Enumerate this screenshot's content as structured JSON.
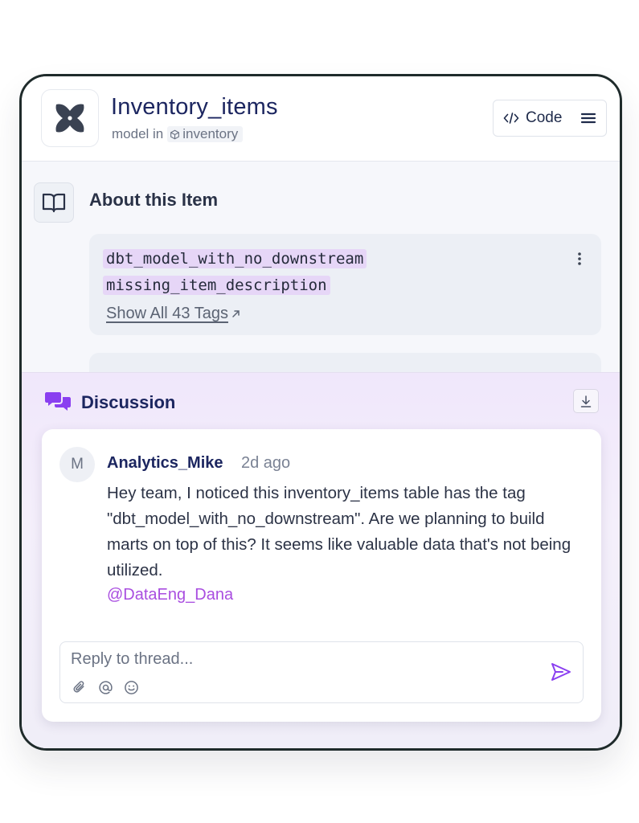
{
  "header": {
    "title": "Inventory_items",
    "subtitle_prefix": "model in",
    "subtitle_project": "inventory",
    "code_label": "Code",
    "logo_icon": "dbt-logo-icon",
    "menu_icon": "hamburger-menu-icon"
  },
  "about": {
    "title": "About this Item",
    "icon": "book-icon",
    "tags": [
      "dbt_model_with_no_downstream",
      "missing_item_description"
    ],
    "show_all_label": "Show All 43 Tags",
    "show_all_icon": "arrow-up-right-icon"
  },
  "discussion": {
    "title": "Discussion",
    "icon": "chat-bubbles-icon",
    "download_icon": "download-icon",
    "comment": {
      "avatar_initial": "M",
      "author": "Analytics_Mike",
      "time": "2d ago",
      "body": "Hey team, I noticed this inventory_items table has the tag \"dbt_model_with_no_downstream\". Are we planning to build marts on top of this? It seems like valuable data that's not being utilized.",
      "mention": "@DataEng_Dana"
    },
    "reply": {
      "placeholder": "Reply to thread...",
      "tools": [
        "paperclip-icon",
        "at-sign-icon",
        "smiley-icon"
      ],
      "send_icon": "send-icon"
    }
  },
  "colors": {
    "accent_purple": "#8a3ff0",
    "mention_purple": "#a94ee0",
    "title_navy": "#1c2660",
    "tag_highlight": "#e6d6f7"
  }
}
